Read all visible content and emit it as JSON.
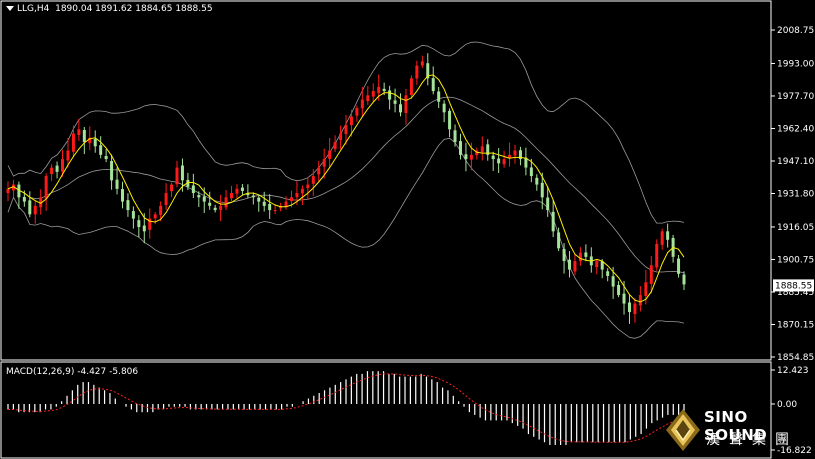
{
  "header": {
    "symbol": "LLG,H4",
    "ohlc": "1890.04 1891.62 1884.65 1888.55"
  },
  "macd_header": {
    "label": "MACD(12,26,9)",
    "values": "-4.427 -5.806"
  },
  "colors": {
    "background": "#000000",
    "bull": "#ff1a1a",
    "bear": "#a6e39a",
    "ma": "#ffee00",
    "bands": "#9a9a9a",
    "axis": "#ffffff",
    "macd_hist": "#ffffff",
    "macd_signal": "#ff2020",
    "last_price_bg": "#ffffff"
  },
  "logo": {
    "name": "SINO SOUND",
    "chinese": "漢聲集團"
  },
  "chart_data": [
    {
      "type": "candlestick",
      "indicators": [
        "Bollinger Bands",
        "Moving Average"
      ],
      "y_ticks": [
        "2008.75",
        "1993.00",
        "1977.70",
        "1962.40",
        "1947.10",
        "1931.80",
        "1916.05",
        "1900.75",
        "1885.45",
        "1870.15",
        "1854.85"
      ],
      "ylim": [
        1854.85,
        2008.75
      ],
      "last_price": "1888.55",
      "closes": [
        1934,
        1936,
        1930,
        1928,
        1922,
        1926,
        1930,
        1940,
        1944,
        1942,
        1948,
        1952,
        1960,
        1962,
        1956,
        1958,
        1954,
        1950,
        1948,
        1938,
        1934,
        1928,
        1924,
        1920,
        1916,
        1914,
        1920,
        1922,
        1926,
        1932,
        1936,
        1944,
        1938,
        1935,
        1932,
        1930,
        1928,
        1926,
        1924,
        1926,
        1930,
        1932,
        1934,
        1933,
        1931,
        1930,
        1928,
        1926,
        1924,
        1924,
        1926,
        1928,
        1930,
        1932,
        1934,
        1936,
        1940,
        1944,
        1948,
        1952,
        1956,
        1960,
        1964,
        1968,
        1972,
        1976,
        1978,
        1980,
        1982,
        1980,
        1976,
        1974,
        1970,
        1978,
        1986,
        1992,
        1994,
        1986,
        1980,
        1975,
        1970,
        1962,
        1956,
        1950,
        1948,
        1950,
        1952,
        1954,
        1950,
        1948,
        1946,
        1948,
        1950,
        1952,
        1948,
        1944,
        1940,
        1936,
        1930,
        1924,
        1914,
        1906,
        1900,
        1896,
        1900,
        1904,
        1902,
        1898,
        1900,
        1896,
        1893,
        1888,
        1884,
        1880,
        1876,
        1880,
        1884,
        1890,
        1898,
        1908,
        1914,
        1910,
        1902,
        1894,
        1889
      ]
    },
    {
      "type": "macd",
      "label": "MACD(12,26,9)",
      "values": [
        -4.427,
        -5.806
      ],
      "y_ticks": [
        "12.423",
        "0.00",
        "-16.822"
      ],
      "ylim": [
        -16.822,
        12.423
      ],
      "histogram": [
        -2,
        -2,
        -3,
        -3,
        -3,
        -3,
        -3,
        -2,
        -2,
        -1,
        1,
        3,
        5,
        7,
        8,
        8,
        7,
        6,
        5,
        4,
        2,
        0,
        -1,
        -2,
        -3,
        -3,
        -3,
        -3,
        -2,
        -2,
        -1,
        -1,
        -1,
        -1,
        -2,
        -2,
        -2,
        -2,
        -2,
        -2,
        -2,
        -2,
        -2,
        -2,
        -2,
        -2,
        -2,
        -2,
        -2,
        -2,
        -2,
        -2,
        -1,
        -1,
        0,
        1,
        2,
        3,
        4,
        5,
        6,
        7,
        8,
        9,
        10,
        11,
        11,
        12,
        12,
        12,
        12,
        11,
        11,
        10,
        10,
        10,
        10,
        11,
        10,
        9,
        8,
        6,
        5,
        3,
        1,
        -1,
        -3,
        -4,
        -5,
        -6,
        -6,
        -6,
        -6,
        -6,
        -7,
        -8,
        -9,
        -11,
        -12,
        -13,
        -14,
        -15,
        -15,
        -15,
        -15,
        -14,
        -14,
        -14,
        -14,
        -14,
        -14,
        -14,
        -14,
        -14,
        -14,
        -14,
        -13,
        -12,
        -11,
        -9,
        -7,
        -6,
        -5,
        -4,
        -4,
        -5,
        -4
      ]
    }
  ]
}
